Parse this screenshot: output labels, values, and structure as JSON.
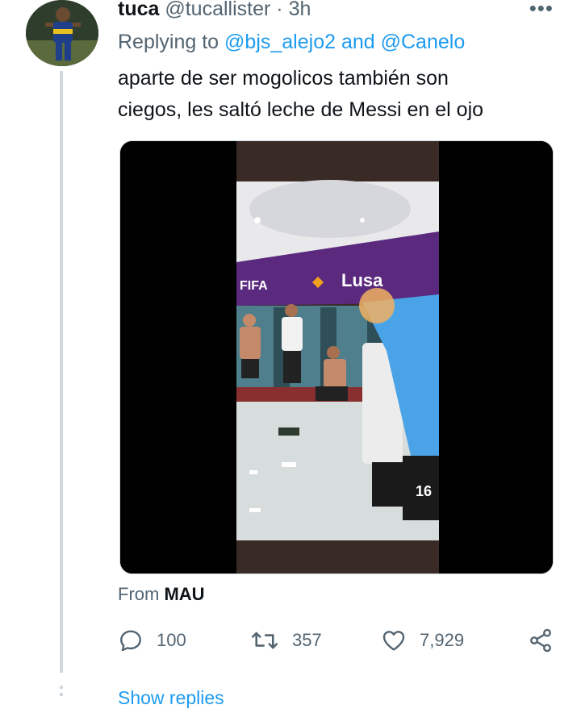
{
  "tweet": {
    "author_name": "tuca",
    "author_handle": "@tucallister",
    "separator": "·",
    "time": "3h",
    "more_label": "•••",
    "replying_prefix": "Replying to",
    "replying_to_1": "@bjs_alejo2",
    "replying_and": "and",
    "replying_to_2": "@Canelo",
    "text_line_1": "aparte de ser mogolicos también son",
    "text_line_2": "ciegos, les saltó leche de Messi en el ojo",
    "media": {
      "banner_fifa": "FIFA",
      "banner_sponsor": "Lusa",
      "jersey_number": "16"
    },
    "source_prefix": "From",
    "source_name": "MAU"
  },
  "actions": {
    "replies": "100",
    "retweets": "357",
    "likes": "7,929"
  },
  "thread": {
    "show_replies": "Show replies"
  },
  "colors": {
    "link": "#1d9bf0",
    "secondary_text": "#536471",
    "thread_line": "#cfd9de"
  },
  "icons": [
    "more-icon",
    "reply-icon",
    "retweet-icon",
    "like-icon",
    "share-icon"
  ]
}
